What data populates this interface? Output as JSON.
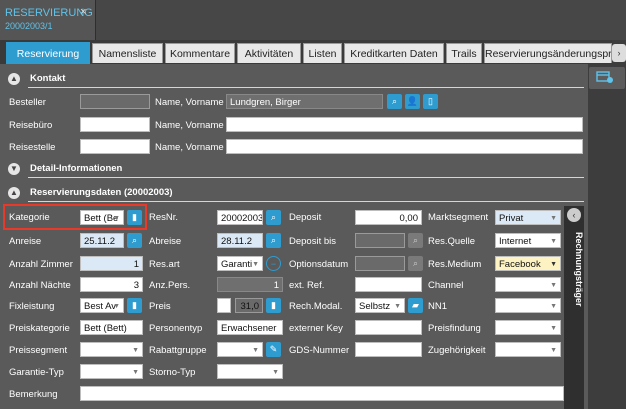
{
  "doc_tab": {
    "title": "RESERVIERUNG",
    "subtitle": "20002003/1",
    "close": "×"
  },
  "tabs": [
    "Reservierung",
    "Namensliste",
    "Kommentare",
    "Aktivitäten",
    "Listen",
    "Kreditkarten Daten",
    "Trails",
    "Reservierungsänderungspro"
  ],
  "tab_scroll": "›",
  "sections": {
    "kontakt": "Kontakt",
    "detail": "Detail-Informationen",
    "resdaten": "Reservierungsdaten (20002003)"
  },
  "kontakt": {
    "besteller": "Besteller",
    "reisebuero": "Reisebüro",
    "reisestelle": "Reisestelle",
    "name_vorname": "Name, Vorname",
    "besteller_name": "Lundgren, Birger"
  },
  "col1": {
    "kategorie": "Kategorie",
    "kategorie_val": "Bett (Be",
    "anreise": "Anreise",
    "anreise_val": "25.11.2",
    "anzahl_zimmer": "Anzahl Zimmer",
    "anzahl_zimmer_val": "1",
    "anzahl_naechte": "Anzahl Nächte",
    "anzahl_naechte_val": "3",
    "fixleistung": "Fixleistung",
    "fixleistung_val": "Best Av",
    "preiskategorie": "Preiskategorie",
    "preiskategorie_val": "Bett (Bett)",
    "preissegment": "Preissegment",
    "garantie_typ": "Garantie-Typ",
    "bemerkung": "Bemerkung"
  },
  "col2": {
    "resnr": "ResNr.",
    "resnr_val": "20002003",
    "abreise": "Abreise",
    "abreise_val": "28.11.2",
    "resart": "Res.art",
    "resart_val": "Garanti",
    "anzpers": "Anz.Pers.",
    "anzpers_val": "1",
    "preis": "Preis",
    "preis_val": "31,0",
    "personentyp": "Personentyp",
    "personentyp_val": "Erwachsener",
    "rabattgruppe": "Rabattgruppe",
    "stornotyp": "Storno-Typ"
  },
  "col3": {
    "deposit": "Deposit",
    "deposit_val": "0,00",
    "deposit_bis": "Deposit bis",
    "optionsdatum": "Optionsdatum",
    "ext_ref": "ext. Ref.",
    "rech_modal": "Rech.Modal.",
    "rech_modal_val": "Selbstz",
    "externer_key": "externer Key",
    "gds_nummer": "GDS-Nummer"
  },
  "col4": {
    "marktsegment": "Marktsegment",
    "marktsegment_val": "Privat",
    "res_quelle": "Res.Quelle",
    "res_quelle_val": "Internet",
    "res_medium": "Res.Medium",
    "res_medium_val": "Facebook",
    "channel": "Channel",
    "nn1": "NN1",
    "preisfindung": "Preisfindung",
    "zugehoerigkeit": "Zugehörigkeit"
  },
  "side_panel": {
    "label": "Rechnungsträger",
    "collapse": "‹"
  },
  "colors": {
    "accent": "#2f9cd0",
    "highlight": "#e8392b",
    "field_blue": "#dbe9f6",
    "field_yellow": "#fdf2c2"
  }
}
